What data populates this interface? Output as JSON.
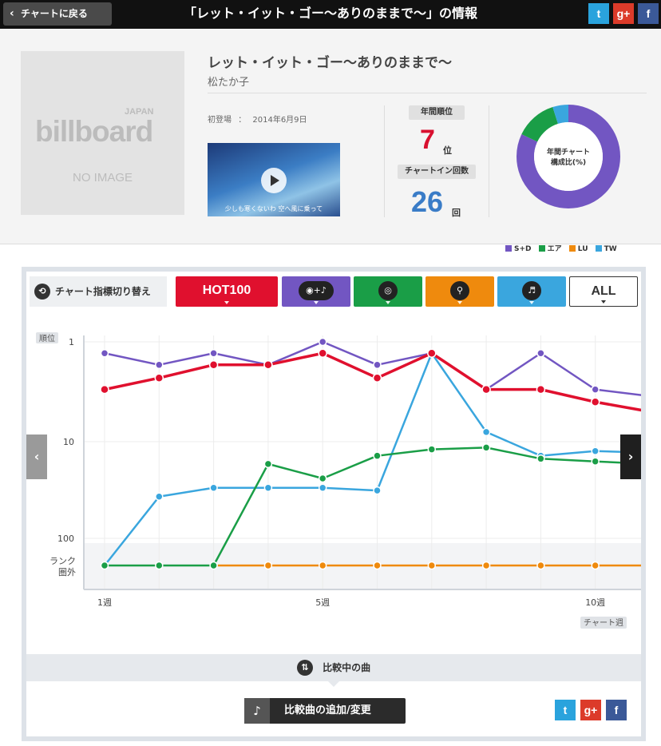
{
  "header": {
    "back_label": "チャートに戻る",
    "title": "「レット・イット・ゴー〜ありのままで〜」の情報",
    "share": {
      "twitter": "t",
      "googleplus": "g+",
      "facebook": "f"
    }
  },
  "song": {
    "title": "レット・イット・ゴー〜ありのままで〜",
    "artist": "松たか子",
    "debut_label": "初登場",
    "debut_sep": "：",
    "debut_date": "2014年6月9日",
    "no_image": {
      "japan": "JAPAN",
      "billboard": "billboard",
      "text": "NO IMAGE"
    },
    "video_caption": "少しも寒くないわ 空へ風に乗って"
  },
  "stats": {
    "annual_rank_label": "年間順位",
    "annual_rank": "7",
    "annual_rank_unit": "位",
    "chart_in_label": "チャートイン回数",
    "chart_in_count": "26",
    "chart_in_unit": "回",
    "donut_title_1": "年間チャート",
    "donut_title_2": "構成比(%)",
    "donut": [
      {
        "label": "S+D",
        "value": 82,
        "color": "#7256c2"
      },
      {
        "label": "エア",
        "value": 13,
        "color": "#1a9e47"
      },
      {
        "label": "LU",
        "value": 0,
        "color": "#ef8a0d"
      },
      {
        "label": "TW",
        "value": 5,
        "color": "#3aa6de"
      }
    ]
  },
  "switcher": {
    "label": "チャート指標切り替え",
    "tabs": [
      {
        "label": "HOT100",
        "color": "#e0102e"
      },
      {
        "label": "",
        "icon": "cd-music-icon",
        "glyph": "◉+♪",
        "color": "#7256c2"
      },
      {
        "label": "",
        "icon": "radio-icon",
        "glyph": "◎",
        "color": "#1a9e47"
      },
      {
        "label": "",
        "icon": "search-icon",
        "glyph": "⚲",
        "color": "#ef8a0d"
      },
      {
        "label": "",
        "icon": "artist-title-icon",
        "glyph": "♬",
        "color": "#3aa6de"
      },
      {
        "label": "ALL",
        "color": "#ffffff"
      }
    ]
  },
  "chart_data": {
    "type": "line",
    "ylabel": "順位",
    "xlabel": "チャート週",
    "y_scale": "log",
    "y_reversed": true,
    "y_ticks": [
      "1",
      "10",
      "100"
    ],
    "out_label_1": "ランク",
    "out_label_2": "圏外",
    "x_ticks": [
      "1週",
      "5週",
      "10週"
    ],
    "x": [
      1,
      2,
      3,
      4,
      5,
      6,
      7,
      8,
      9,
      10,
      11
    ],
    "series": [
      {
        "key": "hot100",
        "color": "#e0102e",
        "values": [
          3,
          2.3,
          1.7,
          1.7,
          1.3,
          2.3,
          1.3,
          3,
          3,
          4,
          5
        ]
      },
      {
        "key": "sd",
        "color": "#7256c2",
        "values": [
          1.3,
          1.7,
          1.3,
          1.7,
          1,
          1.7,
          1.3,
          3,
          1.3,
          3,
          3.5
        ]
      },
      {
        "key": "air",
        "color": "#1a9e47",
        "values": [
          "out",
          "out",
          "out",
          17,
          24,
          14,
          12,
          11.5,
          15,
          16,
          17
        ]
      },
      {
        "key": "lu",
        "color": "#ef8a0d",
        "values": [
          null,
          null,
          "out",
          "out",
          "out",
          "out",
          "out",
          "out",
          "out",
          "out",
          "out"
        ]
      },
      {
        "key": "tw",
        "color": "#3aa6de",
        "values": [
          "out",
          37,
          30,
          30,
          30,
          32,
          1.3,
          8,
          14,
          12.5,
          13
        ]
      }
    ]
  },
  "compare": {
    "label": "比較中の曲",
    "add_label": "比較曲の追加/変更"
  }
}
